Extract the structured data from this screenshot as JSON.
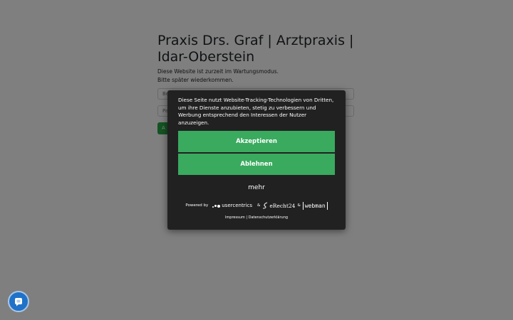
{
  "page": {
    "title": "Praxis Drs. Graf | Arztpraxis | Idar-Oberstein",
    "message_line1": "Diese Website ist zurzeit im Wartungsmodus.",
    "message_line2": "Bitte später wiederkommen.",
    "field1_placeholder": "Be",
    "field2_placeholder": "Pa",
    "submit_label": "A"
  },
  "consent": {
    "text": "Diese Seite nutzt Website-Tracking-Technologien von Dritten, um ihre Dienste anzubieten, stetig zu verbessern und Werbung entsprechend den Interessen der Nutzer anzuzeigen.",
    "accept_label": "Akzeptieren",
    "deny_label": "Ablehnen",
    "more_label": "mehr",
    "powered_by": "Powered by",
    "brand_usercentrics": "usercentrics",
    "ampersand": "&",
    "brand_erecht": "eRecht24",
    "brand_webman": "webman",
    "impressum_label": "Impressum",
    "separator": "|",
    "datenschutz_label": "Datenschutzerklärung",
    "accent_color": "#3aaa5f"
  },
  "chat": {
    "icon": "chat-icon",
    "color": "#1f72c7"
  }
}
